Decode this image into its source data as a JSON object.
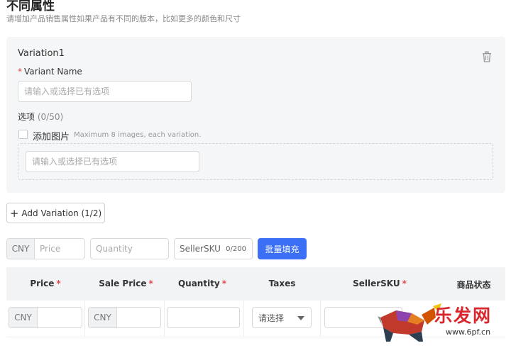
{
  "section": {
    "title": "不同属性",
    "subtitle": "请增加产品销售属性如果产品有不同的版本，比如更多的颜色和尺寸"
  },
  "variation": {
    "title": "Variation1",
    "required_mark": "*",
    "variant_name_label": "Variant Name",
    "variant_name_placeholder": "请输入或选择已有选项",
    "options_label": "选项",
    "options_count": "(0/50)",
    "add_image_label": "添加图片",
    "add_image_hint": "Maximum 8 images, each variation.",
    "option_placeholder": "请输入或选择已有选项"
  },
  "add_variation": {
    "plus": "+",
    "label": "Add Variation (1/2)"
  },
  "batch": {
    "currency": "CNY",
    "price_placeholder": "Price",
    "quantity_placeholder": "Quantity",
    "sku_placeholder": "SellerSKU",
    "sku_count": "0/200",
    "fill_button": "批量填充"
  },
  "table": {
    "columns": [
      "Price",
      "Sale Price",
      "Quantity",
      "Taxes",
      "SellerSKU",
      "商品状态"
    ],
    "required_mark": "*",
    "row": {
      "currency": "CNY",
      "taxes_select": "请选择"
    }
  },
  "watermark": {
    "brand": "乐发网",
    "site": "www.6pf.cn"
  }
}
